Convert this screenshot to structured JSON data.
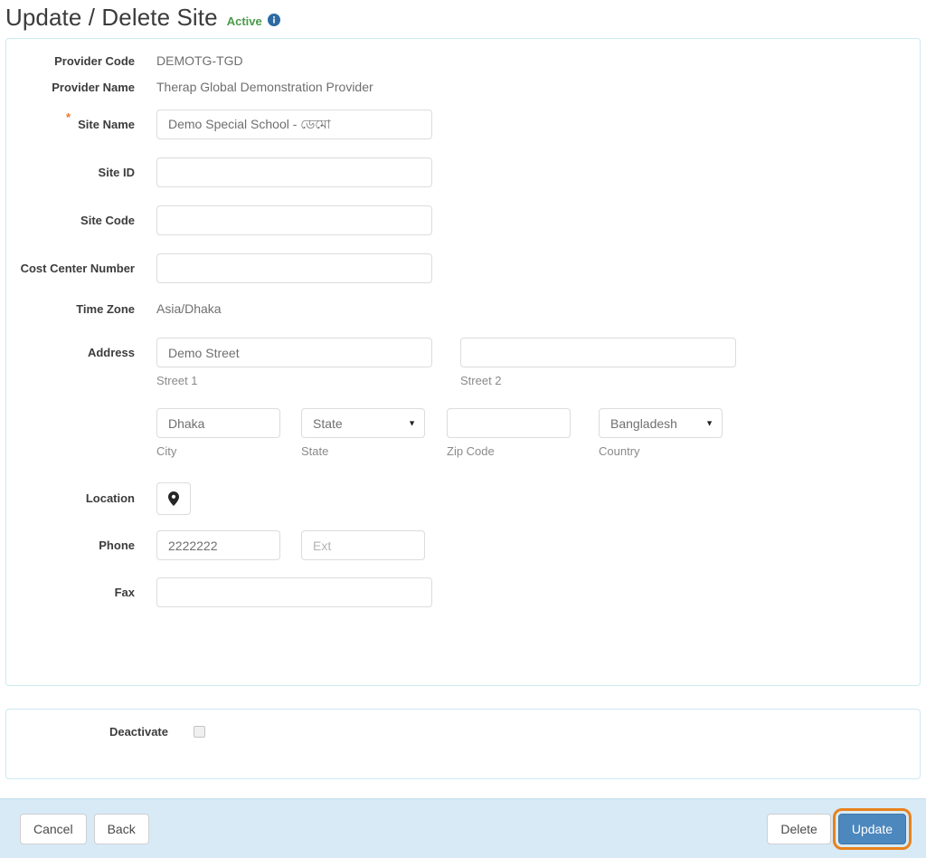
{
  "header": {
    "title": "Update / Delete Site",
    "status": "Active",
    "info_icon": "info-circle-icon"
  },
  "form": {
    "provider_code": {
      "label": "Provider Code",
      "value": "DEMOTG-TGD"
    },
    "provider_name": {
      "label": "Provider Name",
      "value": "Therap Global Demonstration Provider"
    },
    "site_name": {
      "label": "Site Name",
      "required_marker": "*",
      "value": "Demo Special School - ডেমো",
      "placeholder": ""
    },
    "site_id": {
      "label": "Site ID",
      "value": "",
      "placeholder": ""
    },
    "site_code": {
      "label": "Site Code",
      "value": "",
      "placeholder": ""
    },
    "cost_center_number": {
      "label": "Cost Center Number",
      "value": "",
      "placeholder": ""
    },
    "time_zone": {
      "label": "Time Zone",
      "value": "Asia/Dhaka"
    },
    "address": {
      "label": "Address",
      "street1": {
        "value": "Demo Street",
        "helper": "Street 1",
        "placeholder": ""
      },
      "street2": {
        "value": "",
        "helper": "Street 2",
        "placeholder": ""
      },
      "city": {
        "value": "Dhaka",
        "helper": "City",
        "placeholder": ""
      },
      "state": {
        "selected": "State",
        "helper": "State",
        "options": [
          "State"
        ]
      },
      "zip": {
        "value": "",
        "helper": "Zip Code",
        "placeholder": ""
      },
      "country": {
        "selected": "Bangladesh",
        "helper": "Country",
        "options": [
          "Bangladesh"
        ]
      }
    },
    "location": {
      "label": "Location",
      "icon": "map-pin-icon"
    },
    "phone": {
      "label": "Phone",
      "value": "2222222",
      "ext_value": "",
      "ext_placeholder": "Ext"
    },
    "fax": {
      "label": "Fax",
      "value": "",
      "placeholder": ""
    }
  },
  "deactivate": {
    "label": "Deactivate",
    "checked": false
  },
  "footer": {
    "cancel_label": "Cancel",
    "back_label": "Back",
    "delete_label": "Delete",
    "update_label": "Update"
  },
  "colors": {
    "status_green": "#4a9a4a",
    "info_blue": "#2d6ca2",
    "panel_border": "#cdeaf2",
    "primary_button": "#4c87bd",
    "highlight_orange": "#e8821e",
    "required_asterisk": "#e8762c",
    "footer_background": "#d7eaf6"
  }
}
